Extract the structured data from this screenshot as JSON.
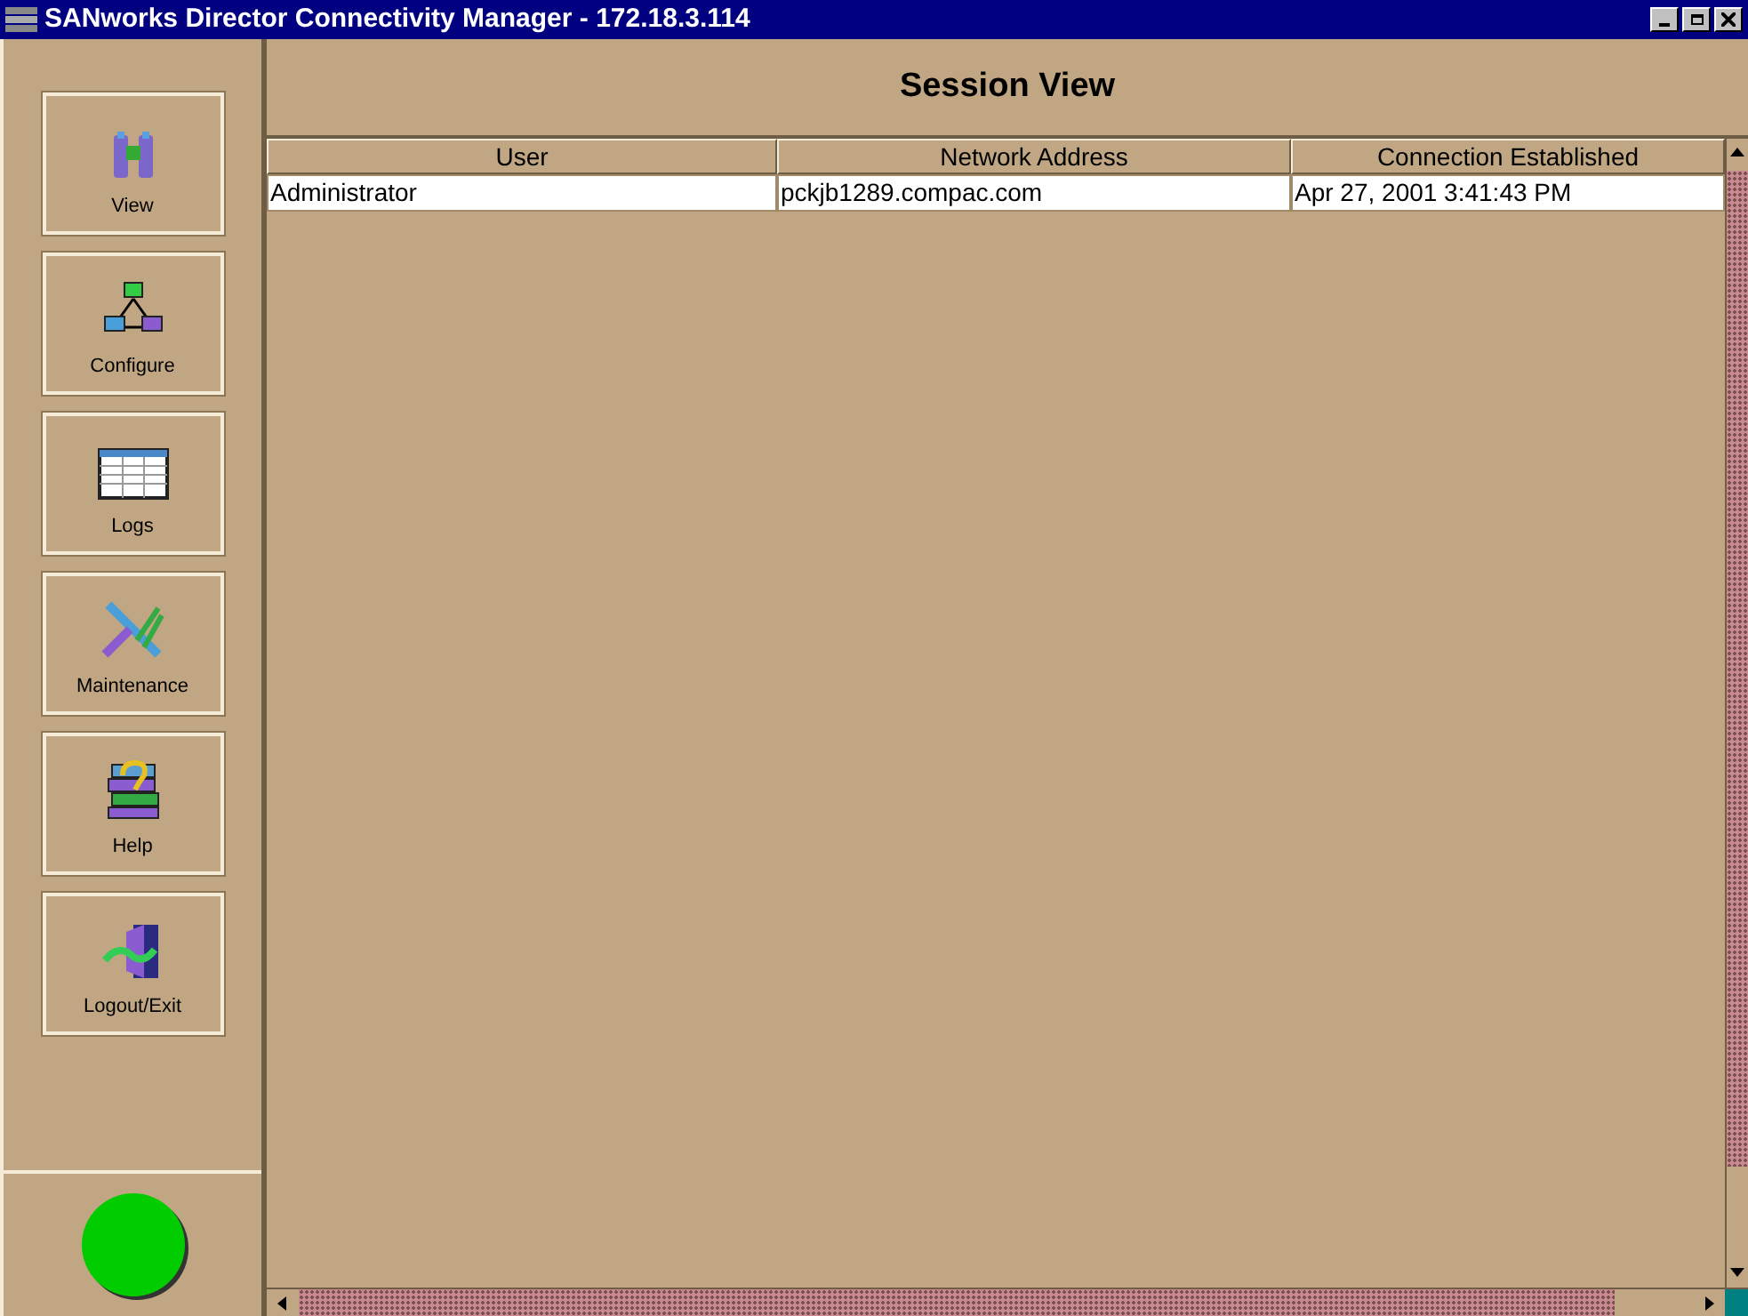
{
  "window": {
    "title": "SANworks Director Connectivity Manager - 172.18.3.114"
  },
  "sidebar": {
    "items": [
      {
        "label": "View",
        "kind": "binoculars"
      },
      {
        "label": "Configure",
        "kind": "network"
      },
      {
        "label": "Logs",
        "kind": "table"
      },
      {
        "label": "Maintenance",
        "kind": "tools"
      },
      {
        "label": "Help",
        "kind": "books"
      },
      {
        "label": "Logout/Exit",
        "kind": "exit"
      }
    ]
  },
  "panel": {
    "title": "Session View"
  },
  "table": {
    "columns": [
      "User",
      "Network Address",
      "Connection Established"
    ],
    "rows": [
      [
        "Administrator",
        "pckjb1289.compac.com",
        "Apr 27, 2001 3:41:43 PM"
      ]
    ]
  }
}
